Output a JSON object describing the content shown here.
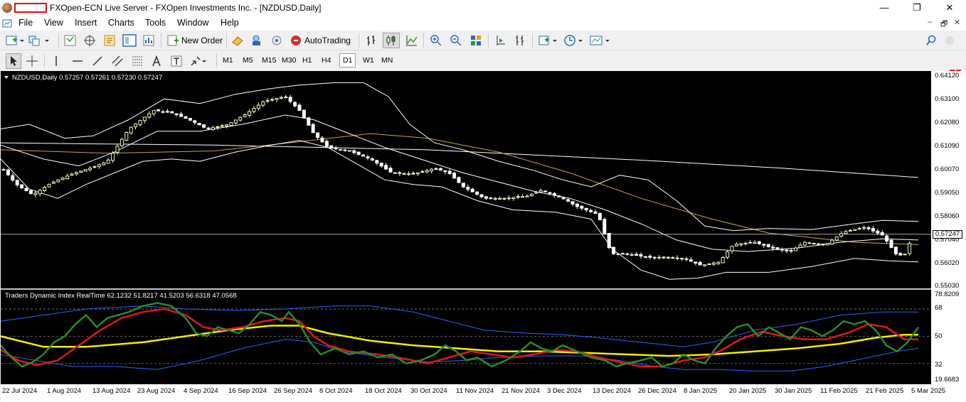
{
  "window": {
    "title": "FXOpen-ECN Live Server - FXOpen Investments Inc. - [NZDUSD,Daily]",
    "controls": {
      "minimize": "—",
      "restore": "❐",
      "close": "✕"
    }
  },
  "menu": {
    "items": [
      "File",
      "View",
      "Insert",
      "Charts",
      "Tools",
      "Window",
      "Help"
    ],
    "mdi_controls": {
      "minimize": "–",
      "restore": "🗗",
      "close": "✕"
    }
  },
  "toolbar": {
    "new_order_label": "New Order",
    "autotrading_label": "AutoTrading",
    "notification_count": "1"
  },
  "timeframes": {
    "items": [
      "M1",
      "M5",
      "M15",
      "M30",
      "H1",
      "H4",
      "D1",
      "W1",
      "MN"
    ],
    "active": "D1"
  },
  "chart": {
    "header": "NZDUSD,Daily  0.57257 0.57261 0.57230 0.57247",
    "current_price": "0.57247",
    "price_labels": [
      "0.64120",
      "0.63100",
      "0.62080",
      "0.61090",
      "0.60070",
      "0.59050",
      "0.58060",
      "0.57040",
      "0.56020",
      "0.55030"
    ],
    "date_labels": [
      "22 Jul 2024",
      "1 Aug 2024",
      "13 Aug 2024",
      "23 Aug 2024",
      "4 Sep 2024",
      "16 Sep 2024",
      "26 Sep 2024",
      "8 Oct 2024",
      "18 Oct 2024",
      "30 Oct 2024",
      "11 Nov 2024",
      "21 Nov 2024",
      "3 Dec 2024",
      "13 Dec 2024",
      "26 Dec 2024",
      "8 Jan 2025",
      "20 Jan 2025",
      "30 Jan 2025",
      "11 Feb 2025",
      "21 Feb 2025",
      "5 Mar 2025"
    ],
    "colors": {
      "background": "#000000",
      "bull": "#e6ffc0",
      "bear": "#ffffff",
      "bands": "#ffffff",
      "ma_slow": "#ffffff",
      "ma_mid": "#c8a050"
    }
  },
  "indicator": {
    "header": "Traders Dynamic Index RealTime 62.1232 51.8217 41.5203 56.6318 47.0568",
    "level_labels": [
      "78.8209",
      "68",
      "50",
      "32",
      "19.6683"
    ],
    "colors": {
      "green": "#2a8a2a",
      "red": "#e01818",
      "yellow": "#f0f000",
      "blue": "#3060ff"
    }
  }
}
